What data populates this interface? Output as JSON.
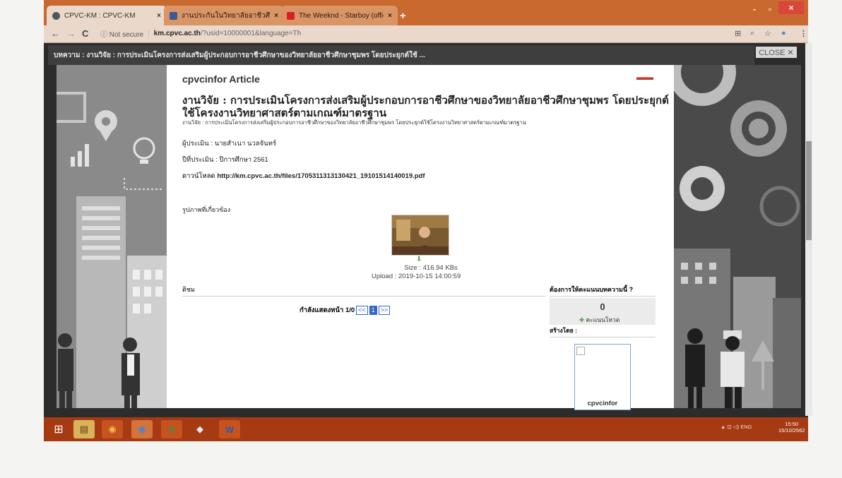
{
  "browser": {
    "tabs": [
      {
        "label": "CPVC-KM : CPVC-KM",
        "close": "×"
      },
      {
        "label": "งานประกันในวิทยาลัยอาชีวศึก",
        "close": "×"
      },
      {
        "label": "The Weeknd - Starboy (official)",
        "close": "×"
      }
    ],
    "new_tab": "+",
    "window_controls": {
      "minimize": "-",
      "maximize": "▫",
      "close": "×"
    },
    "nav": {
      "back": "←",
      "forward": "→",
      "reload": "C"
    },
    "security": "ⓘ Not secure",
    "url_domain": "km.cpvc.ac.th",
    "url_path": "/?usid=10000001&language=Th",
    "right_icons": {
      "translate": "⊞",
      "zoom": "⌕",
      "bookmark": "☆",
      "profile": "●",
      "menu": "⋮"
    }
  },
  "popup": {
    "header": "บทความ : งานวิจัย : การประเมินโครงการส่งเสริมผู้ประกอบการอาชีวศึกษาของวิทยาลัยอาชีวศึกษาชุมพร โดยประยุกต์ใช้ ...",
    "close_label": "CLOSE ✕"
  },
  "article": {
    "site_title": "cpvcinfor Article",
    "flag": "▬▬",
    "heading": "งานวิจัย : การประเมินโครงการส่งเสริมผู้ประกอบการอาชีวศึกษาของวิทยาลัยอาชีวศึกษาชุมพร โดยประยุกต์ใช้โครงงานวิทยาศาสตร์ตามเกณฑ์มาตรฐาน",
    "subheading": "งานวิจัย : การประเมินโครงการส่งเสริมผู้ประกอบการอาชีวศึกษาของวิทยาลัยอาชีวศึกษาชุมพร โดยประยุกต์ใช้โครงงานวิทยาศาสตร์ตามเกณฑ์มาตรฐาน",
    "evaluator": "ผู้ประเมิน : นายสำเนา นวลจันทร์",
    "year": "ปีที่ประเมิน : ปีการศึกษา 2561",
    "download_label": "ดาวน์โหลด",
    "download_link": "http://km.cpvc.ac.th/files/1705311313130421_19101514140019.pdf",
    "gallery_label": "รูปภาพที่เกี่ยวข้อง",
    "download_icon": "⬇",
    "file_size": "Size : 416.94 KBs",
    "upload": "Upload : 2019-10-15 14:00:59",
    "comments_header": "ติชม",
    "pager_text": "กำลังแสดงหน้า 1/0",
    "pager_prev": "<<",
    "pager_current": "1",
    "pager_next": ">>",
    "vote_question": "ต้องการให้คะแนนบทความนี้ ?",
    "vote_count": "0",
    "vote_button": "คะแนนโหวต",
    "created_by": "สร้างโดย :",
    "author": "cpvcinfor"
  },
  "taskbar": {
    "items": [
      {
        "name": "start",
        "glyph": "⊞"
      },
      {
        "name": "file-explorer",
        "glyph": "▤"
      },
      {
        "name": "chrome",
        "glyph": "◉"
      },
      {
        "name": "chrome-2",
        "glyph": "◉"
      },
      {
        "name": "excel",
        "glyph": "X"
      },
      {
        "name": "app-hat",
        "glyph": "◆"
      },
      {
        "name": "word",
        "glyph": "W"
      }
    ],
    "tray": "▲  ⊡  ◁)  ENG",
    "time": "15:50",
    "date": "15/10/2562"
  },
  "colors": {
    "tabbar": "#c9682f",
    "taskbar": "#a53a13",
    "link": "#3366cc"
  }
}
